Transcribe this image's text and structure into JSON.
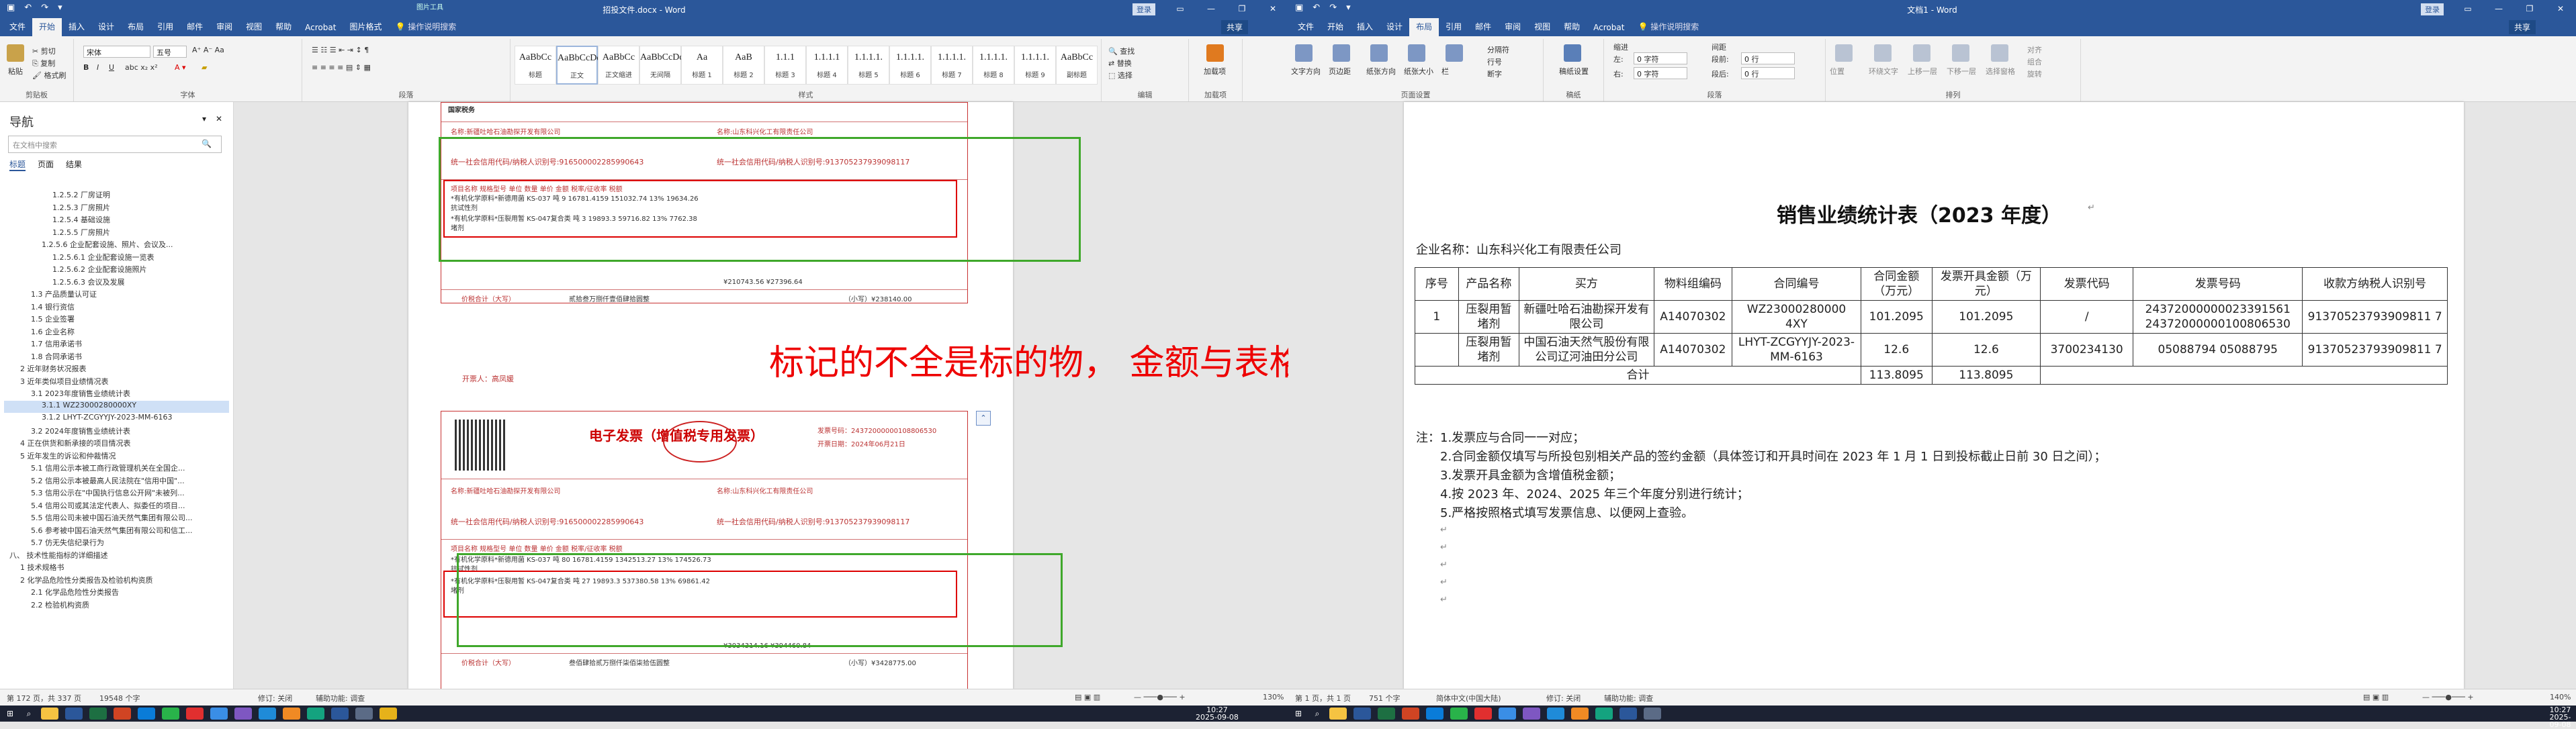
{
  "left_window": {
    "title": "招投文件.docx - Word",
    "context_tab": "图片工具",
    "signin": "登录",
    "share": "共享",
    "tabs": [
      "文件",
      "开始",
      "插入",
      "设计",
      "布局",
      "引用",
      "邮件",
      "审阅",
      "视图",
      "帮助",
      "Acrobat",
      "图片格式"
    ],
    "active_tab": "开始",
    "tell_me": "操作说明搜索",
    "clipboard": {
      "paste": "粘贴",
      "cut": "剪切",
      "copy": "复制",
      "format": "格式刷",
      "label": "剪贴板"
    },
    "font": {
      "name": "宋体",
      "size": "五号",
      "label": "字体"
    },
    "paragraph_label": "段落",
    "styles": [
      {
        "preview": "AaBbCc",
        "name": "标题"
      },
      {
        "preview": "AaBbCcDd",
        "name": "正文"
      },
      {
        "preview": "AaBbCc",
        "name": "正文缩进"
      },
      {
        "preview": "AaBbCcDd",
        "name": "无间隔"
      },
      {
        "preview": "Aa",
        "name": "标题 1"
      },
      {
        "preview": "AaB",
        "name": "标题 2"
      },
      {
        "preview": "1.1.1",
        "name": "标题 3"
      },
      {
        "preview": "1.1.1.1",
        "name": "标题 4"
      },
      {
        "preview": "1.1.1.1.",
        "name": "标题 5"
      },
      {
        "preview": "1.1.1.1.",
        "name": "标题 6"
      },
      {
        "preview": "1.1.1.1.",
        "name": "标题 7"
      },
      {
        "preview": "1.1.1.1.",
        "name": "标题 8"
      },
      {
        "preview": "1.1.1.1.",
        "name": "标题 9"
      },
      {
        "preview": "AaBbCc",
        "name": "副标题"
      }
    ],
    "styles_label": "样式",
    "editing": {
      "find": "查找",
      "replace": "替换",
      "select": "选择",
      "label": "编辑"
    },
    "addin": {
      "label": "加载项",
      "name": "加载项"
    },
    "nav": {
      "title": "导航",
      "search_placeholder": "在文档中搜索",
      "tabs": [
        "标题",
        "页面",
        "结果"
      ],
      "items": [
        "1.2.5.2 厂房证明",
        "1.2.5.3 厂房照片",
        "1.2.5.4 基础设施",
        "1.2.5.5 厂房照片",
        "1.2.5.6 企业配套设施、照片、会议及...",
        "1.2.5.6.1 企业配套设施一览表",
        "1.2.5.6.2 企业配套设施照片",
        "1.2.5.6.3 会议及发展",
        "1.3 产品质量认可证",
        "1.4 银行资信",
        "1.5 企业签署",
        "1.6 企业名称",
        "1.7 信用承诺书",
        "1.8 合同承诺书",
        "2 近年财务状况报表",
        "3 近年类似项目业绩情况表",
        "3.1 2023年度销售业绩统计表",
        "3.1.1 WZ23000280000XY",
        "3.1.2 LHYT-ZCGYYJY-2023-MM-6163",
        "3.2 2024年度销售业绩统计表",
        "4 正在供货和新承接的项目情况表",
        "5 近年发生的诉讼和仲裁情况",
        "5.1 信用公示本被工商行政管理机关在全国企...",
        "5.2 信用公示本被最高人民法院在\"信用中国\"...",
        "5.3 信用公示在\"中国执行信息公开网\"未被列...",
        "5.4 信用公司或其法定代表人、拟委任的项目...",
        "5.5 信用公司未被中国石油天然气集团有限公司...",
        "5.6 参考被中国石油天然气集团有限公司和信工...",
        "5.7 仿无失信纪录行为",
        "八、 技术性能指标的详细描述",
        "1 技术规格书",
        "2 化学品危险性分类报告及检验机构资质",
        "2.1 化学品危险性分类报告",
        "2.2 检验机构资质"
      ],
      "selected_index": 17
    },
    "invoice1": {
      "buyer_label": "名称:新疆吐哈石油勘探开发有限公司",
      "buyer_tax": "统一社会信用代码/纳税人识别号:916500002285990643",
      "seller_label": "名称:山东科兴化工有限责任公司",
      "seller_tax": "统一社会信用代码/纳税人识别号:913705237939098117",
      "header": "项目名称    规格型号    单位    数量    单价    金额    税率/征收率    税额",
      "row1": "*有机化学原料*新德用菌 KS-037  吨  9  16781.4159  151032.74  13%  19634.26",
      "row1b": "抗试性剂",
      "row2": "*有机化学原料*压裂用暂 KS-047复合类  吨  3  19893.3  59716.82  13%  7762.38",
      "row2b": "堵剂",
      "total_line": "¥210743.56                      ¥27396.64",
      "amount_words_label": "价税合计（大写）",
      "amount_words": "贰拾叁万捌仟壹佰肆拾圆整",
      "amount_small": "（小写）¥238140.00",
      "issuer": "开票人：高凤媛"
    },
    "invoice2": {
      "title": "电子发票（增值税专用发票）",
      "invoice_no": "发票号码：24372000000108806530",
      "date": "开票日期：2024年06月21日",
      "buyer_label": "名称:新疆吐哈石油勘探开发有限公司",
      "buyer_tax": "统一社会信用代码/纳税人识别号:916500002285990643",
      "seller_label": "名称:山东科兴化工有限责任公司",
      "seller_tax": "统一社会信用代码/纳税人识别号:913705237939098117",
      "header": "项目名称    规格型号    单位    数量    单价    金额    税率/征收率    税额",
      "row1": "*有机化学原料*新德用菌 KS-037  吨  80  16781.4159  1342513.27  13%  174526.73",
      "row1b": "抗试性剂",
      "row2": "*有机化学原料*压裂用暂 KS-047复合类  吨  27  19893.3  537380.58  13%  69861.42",
      "row2b": "堵剂",
      "total_line": "¥3034314.16                      ¥394460.84",
      "amount_words_label": "价税合计（大写）",
      "amount_words": "叁佰肆拾贰万捌仟柒佰柒拾伍圆整",
      "amount_small": "（小写）¥3428775.00"
    },
    "annotation": "标记的不全是标的物， 金额与表格不符",
    "status": {
      "page": "第 172 页，共 337 页",
      "words": "19548 个字",
      "track": "修订: 关闭",
      "access": "辅助功能: 调查",
      "zoom": "130%"
    }
  },
  "right_window": {
    "title": "文档1 - Word",
    "signin": "登录",
    "share": "共享",
    "tabs": [
      "文件",
      "开始",
      "插入",
      "设计",
      "布局",
      "引用",
      "邮件",
      "审阅",
      "视图",
      "帮助",
      "Acrobat"
    ],
    "active_tab": "布局",
    "tell_me": "操作说明搜索",
    "page_setup": [
      "文字方向",
      "页边距",
      "纸张方向",
      "纸张大小",
      "栏",
      "分隔符",
      "行号",
      "断字"
    ],
    "page_setup_label": "页面设置",
    "draft": {
      "name": "稿纸设置",
      "label": "稿纸"
    },
    "indent": {
      "heading": "缩进",
      "left_label": "左:",
      "left": "0 字符",
      "right_label": "右:",
      "right": "0 字符"
    },
    "spacing": {
      "heading": "间距",
      "before_label": "段前:",
      "before": "0 行",
      "after_label": "段后:",
      "after": "0 行"
    },
    "paragraph_label": "段落",
    "arrange": [
      "位置",
      "环绕文字",
      "上移一层",
      "下移一层",
      "选择窗格",
      "对齐",
      "组合",
      "旋转"
    ],
    "arrange_label": "排列",
    "doc": {
      "title": "销售业绩统计表（2023 年度）",
      "company": "企业名称：山东科兴化工有限责任公司",
      "headers": [
        "序号",
        "产品名称",
        "买方",
        "物料组编码",
        "合同编号",
        "合同金额（万元）",
        "发票开具金额（万元）",
        "发票代码",
        "发票号码",
        "收款方纳税人识别号"
      ],
      "rows": [
        [
          "1",
          "压裂用暂堵剂",
          "新疆吐哈石油勘探开发有限公司",
          "A14070302",
          "WZ23000280000 4XY",
          "101.2095",
          "101.2095",
          "/",
          "24372000000023391561 24372000000100806530",
          "91370523793909811 7"
        ],
        [
          "",
          "压裂用暂堵剂",
          "中国石油天然气股份有限公司辽河油田分公司",
          "A14070302",
          "LHYT-ZCGYYJY-2023-MM-6163",
          "12.6",
          "12.6",
          "3700234130",
          "05088794 05088795",
          "91370523793909811 7"
        ]
      ],
      "total_label": "合计",
      "total_contract": "113.8095",
      "total_invoice": "113.8095",
      "notes": [
        "注：1.发票应与合同一一对应；",
        "2.合同金额仅填写与所投包别相关产品的签约金额（具体签订和开具时间在 2023 年 1 月 1 日到投标截止日前 30 日之间）；",
        "3.发票开具金额为含增值税金额；",
        "4.按 2023 年、2024、2025 年三个年度分别进行统计；",
        "5.严格按照格式填写发票信息、以便网上查验。"
      ]
    },
    "status": {
      "page": "第 1 页，共 1 页",
      "words": "751 个字",
      "lang": "简体中文(中国大陆)",
      "track": "修订: 关闭",
      "access": "辅助功能: 调查",
      "zoom": "140%"
    }
  },
  "taskbar": {
    "clock_left_time": "10:27",
    "clock_left_date": "2025-09-08",
    "clock_right_time": "10:27",
    "clock_right_date": "2025-09-08"
  }
}
